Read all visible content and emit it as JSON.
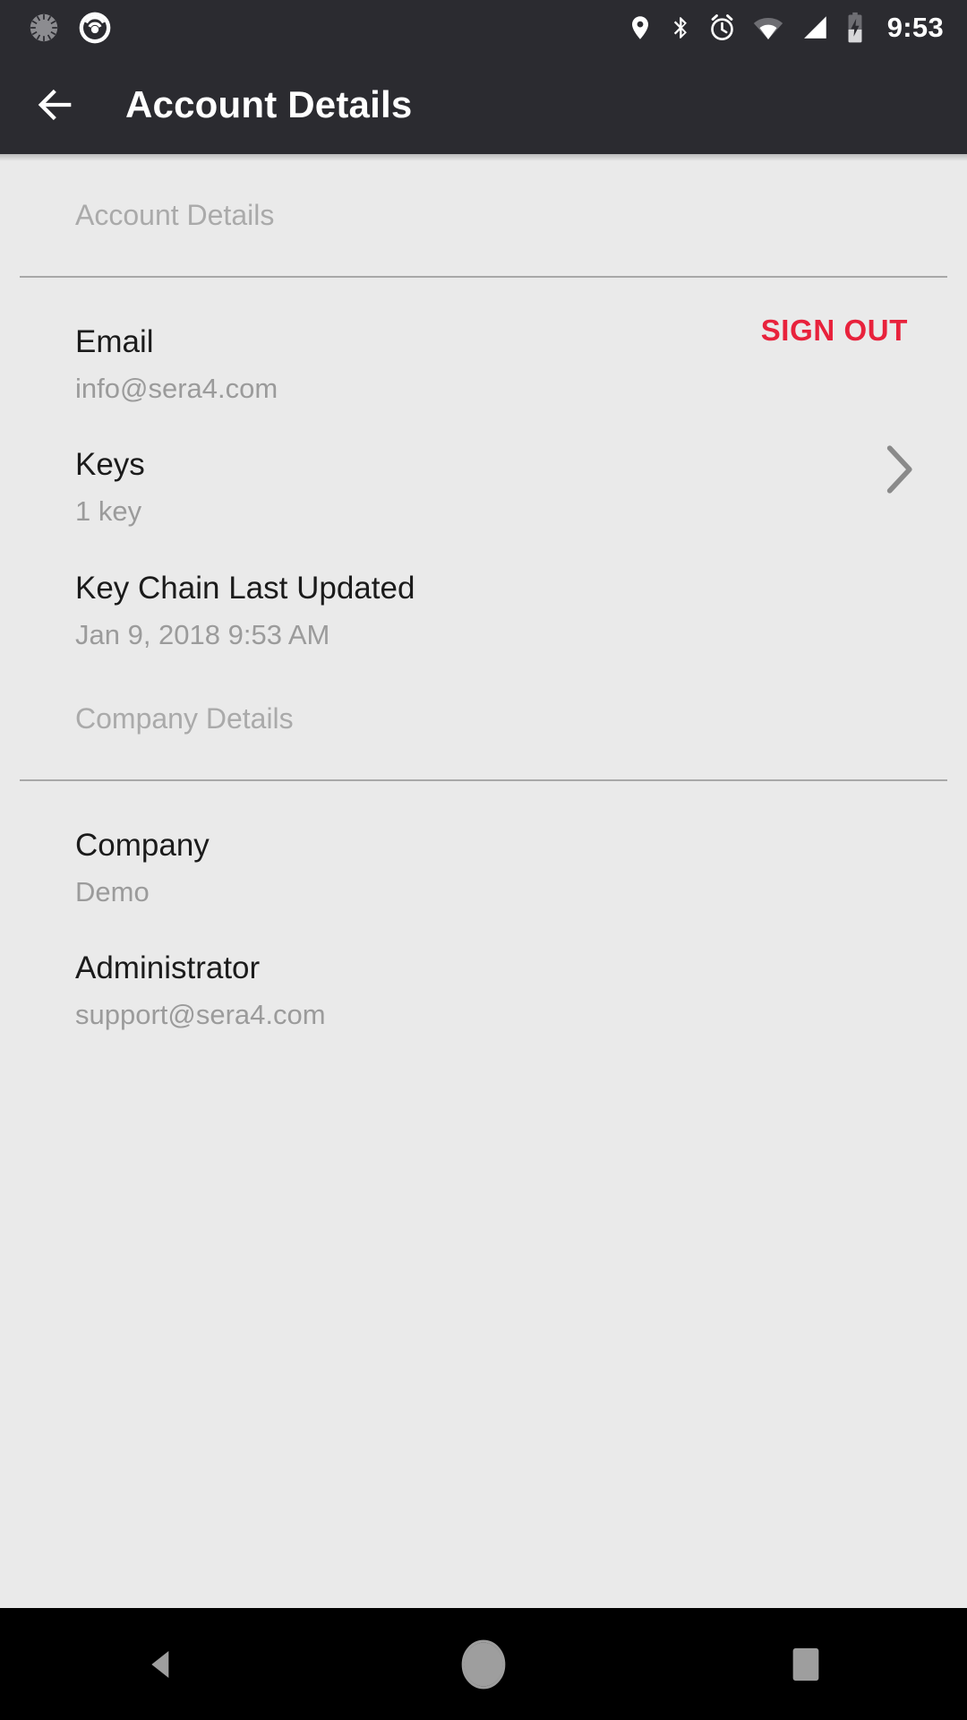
{
  "status_bar": {
    "time": "9:53",
    "notification_icons": [
      "sync-spinner-icon",
      "beacon-sensor-icon"
    ],
    "system_icons": [
      "location-pin-icon",
      "bluetooth-icon",
      "alarm-clock-icon",
      "wifi-icon",
      "cellular-signal-icon",
      "battery-charging-icon"
    ]
  },
  "app_bar": {
    "back_icon": "arrow-left-icon",
    "title": "Account Details"
  },
  "colors": {
    "bar_background": "#2B2B30",
    "page_background": "#EAEAEA",
    "label_text": "#1B1B1B",
    "value_text": "#9B9B9B",
    "section_header_text": "#AAAAAA",
    "divider": "#A8A8A8",
    "sign_out_accent": "#E8223C",
    "nav_bar_background": "#000000",
    "nav_icon": "#9E9E9E"
  },
  "sections": [
    {
      "header": "Account Details",
      "rows": [
        {
          "label": "Email",
          "value": "info@sera4.com",
          "action_label": "SIGN OUT",
          "action_name": "sign-out-button",
          "chevron": false
        },
        {
          "label": "Keys",
          "value": "1 key",
          "action_label": "",
          "action_name": "",
          "chevron": true
        },
        {
          "label": "Key Chain Last Updated",
          "value": "Jan 9, 2018 9:53 AM",
          "action_label": "",
          "action_name": "",
          "chevron": false
        }
      ]
    },
    {
      "header": "Company Details",
      "rows": [
        {
          "label": "Company",
          "value": "Demo",
          "action_label": "",
          "action_name": "",
          "chevron": false
        },
        {
          "label": "Administrator",
          "value": "support@sera4.com",
          "action_label": "",
          "action_name": "",
          "chevron": false
        }
      ]
    }
  ],
  "nav_bar": {
    "back_label": "back-triangle-icon",
    "home_label": "home-circle-icon",
    "recents_label": "recents-square-icon"
  }
}
